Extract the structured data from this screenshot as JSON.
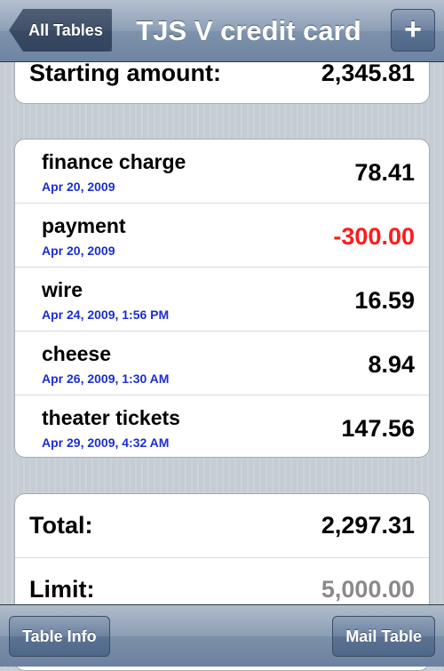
{
  "nav": {
    "back_label": "All Tables",
    "title": "TJS V credit card",
    "add_label": "+"
  },
  "starting": {
    "label": "Starting amount:",
    "value": "2,345.81"
  },
  "transactions": [
    {
      "name": "finance charge",
      "date": "Apr 20, 2009",
      "amount": "78.41"
    },
    {
      "name": "payment",
      "date": "Apr 20, 2009",
      "amount": "-300.00"
    },
    {
      "name": "wire",
      "date": "Apr 24, 2009, 1:56 PM",
      "amount": "16.59"
    },
    {
      "name": "cheese",
      "date": "Apr 26, 2009, 1:30 AM",
      "amount": "8.94"
    },
    {
      "name": "theater tickets",
      "date": "Apr 29, 2009, 4:32 AM",
      "amount": "147.56"
    }
  ],
  "totals": {
    "total_label": "Total:",
    "total_value": "2,297.31",
    "limit_label": "Limit:",
    "limit_value": "5,000.00"
  },
  "toolbar": {
    "table_info_label": "Table Info",
    "mail_table_label": "Mail Table"
  },
  "colors": {
    "date_text": "#1c2ecf",
    "negative_amount": "#ff1a1a",
    "muted_value": "#8a8a8a"
  }
}
